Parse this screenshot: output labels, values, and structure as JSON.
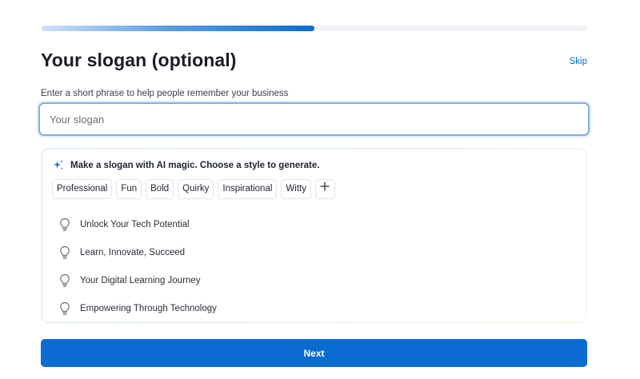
{
  "progress": {
    "fraction": 0.5
  },
  "header": {
    "title": "Your slogan (optional)",
    "skip_label": "Skip"
  },
  "form": {
    "label": "Enter a short phrase to help people remember your business",
    "slogan_placeholder": "Your slogan",
    "slogan_value": ""
  },
  "ai_panel": {
    "heading": "Make a slogan with AI magic. Choose a style to generate.",
    "heading_icon": "sparkle-icon",
    "styles": [
      "Professional",
      "Fun",
      "Bold",
      "Quirky",
      "Inspirational",
      "Witty"
    ],
    "add_style_icon": "plus-icon",
    "suggestion_icon": "lightbulb-icon",
    "suggestions": [
      "Unlock Your Tech Potential",
      "Learn, Innovate, Succeed",
      "Your Digital Learning Journey",
      "Empowering Through Technology"
    ]
  },
  "footer": {
    "next_label": "Next"
  },
  "colors": {
    "accent": "#0b6bd3",
    "text": "#1a1d26",
    "input_focus_border": "#7fb1e6"
  }
}
